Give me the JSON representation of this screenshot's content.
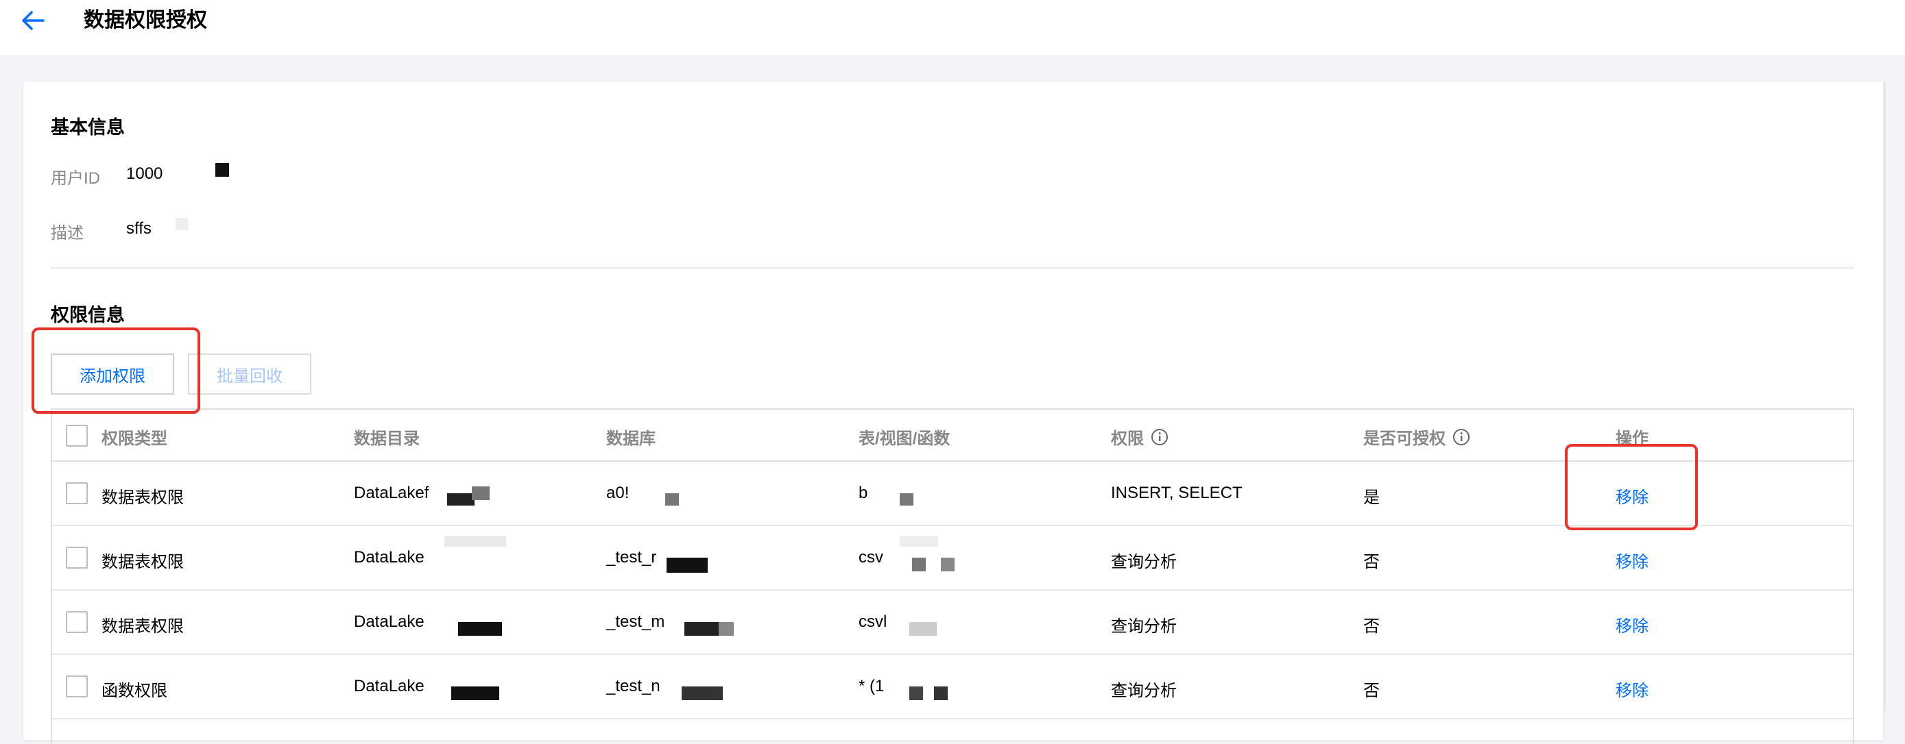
{
  "header": {
    "title": "数据权限授权"
  },
  "basic_info": {
    "section_title": "基本信息",
    "user_id_label": "用户ID",
    "user_id_value": "1000",
    "description_label": "描述",
    "description_value": "sffs"
  },
  "permissions": {
    "section_title": "权限信息",
    "add_button": "添加权限",
    "batch_revoke_button": "批量回收",
    "columns": {
      "type": "权限类型",
      "catalog": "数据目录",
      "database": "数据库",
      "table": "表/视图/函数",
      "permission": "权限",
      "grantable": "是否可授权",
      "action": "操作"
    },
    "rows": [
      {
        "type": "数据表权限",
        "catalog": "DataLakef",
        "database": "a0!",
        "table": "b",
        "permission": "INSERT, SELECT",
        "grantable": "是",
        "action": "移除"
      },
      {
        "type": "数据表权限",
        "catalog": "DataLake",
        "database": "_test_r",
        "table": "csv",
        "permission": "查询分析",
        "grantable": "否",
        "action": "移除"
      },
      {
        "type": "数据表权限",
        "catalog": "DataLake",
        "database": "_test_m",
        "table": "csvl",
        "permission": "查询分析",
        "grantable": "否",
        "action": "移除"
      },
      {
        "type": "函数权限",
        "catalog": "DataLake",
        "database": "_test_n",
        "table": "* (1",
        "permission": "查询分析",
        "grantable": "否",
        "action": "移除"
      }
    ]
  },
  "colors": {
    "accent": "#006eff",
    "highlight": "#e8332d",
    "muted_text": "#888888"
  },
  "icons": {
    "back": "arrow-left-icon",
    "info": "info-circle-icon"
  }
}
